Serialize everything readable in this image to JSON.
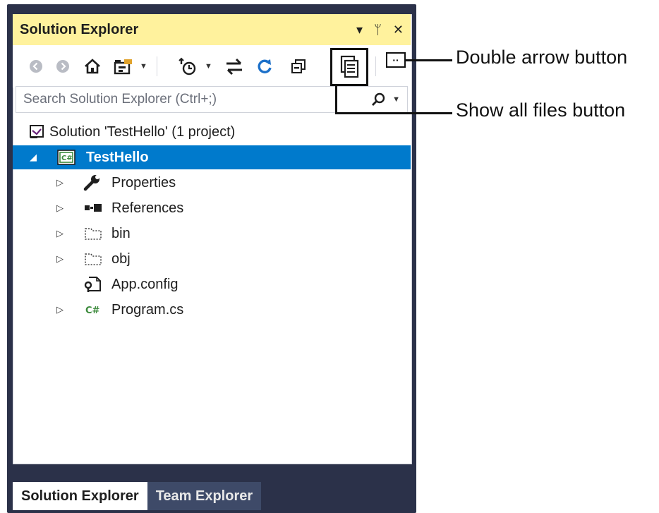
{
  "window": {
    "title": "Solution Explorer",
    "title_actions": [
      "▾",
      "ᛘ",
      "✕"
    ]
  },
  "toolbar": {
    "buttons": [
      "back-icon",
      "forward-icon",
      "home-icon",
      "switch-views-icon",
      "pending-changes-filter-icon",
      "sync-with-active-document-icon",
      "refresh-icon",
      "collapse-all-icon",
      "show-all-files-icon"
    ],
    "double_arrow_label": "··"
  },
  "search": {
    "placeholder": "Search Solution Explorer (Ctrl+;)",
    "value": ""
  },
  "tree": {
    "solution": "Solution 'TestHello' (1 project)",
    "project": "TestHello",
    "items": [
      {
        "label": "Properties",
        "icon": "wrench-icon",
        "expandable": true
      },
      {
        "label": "References",
        "icon": "references-icon",
        "expandable": true
      },
      {
        "label": "bin",
        "icon": "folder-icon",
        "expandable": true
      },
      {
        "label": "obj",
        "icon": "folder-icon",
        "expandable": true
      },
      {
        "label": "App.config",
        "icon": "config-file-icon",
        "expandable": false
      },
      {
        "label": "Program.cs",
        "icon": "csharp-file-icon",
        "expandable": true
      }
    ]
  },
  "tabs": [
    {
      "label": "Solution Explorer",
      "active": true
    },
    {
      "label": "Team Explorer",
      "active": false
    }
  ],
  "callouts": {
    "double_arrow": "Double arrow button",
    "show_all_files": "Show all files button"
  },
  "colors": {
    "frame": "#2b3149",
    "title_bar": "#fff29d",
    "selection": "#007acc",
    "inactive_tab": "#3e4a68"
  }
}
